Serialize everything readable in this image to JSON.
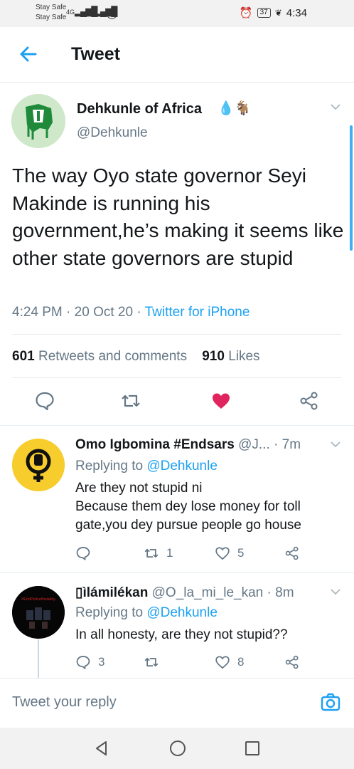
{
  "status_bar": {
    "carrier_1": "Stay Safe",
    "carrier_2": "Stay Safe",
    "signal_1": "4G",
    "signal_2": "4G",
    "battery": "37",
    "time": "4:34"
  },
  "app_bar": {
    "title": "Tweet"
  },
  "tweet": {
    "author_name": "Dehkunle of Africa",
    "author_emoji": "💧🐐",
    "author_handle": "@Dehkunle",
    "text": "The way Oyo state governor Seyi Makinde is running his government,he’s making it seems like other state governors are stupid",
    "time": "4:24 PM",
    "date": "20 Oct 20",
    "source": "Twitter for iPhone",
    "retweets_count": "601",
    "retweets_label": "Retweets and comments",
    "likes_count": "910",
    "likes_label": "Likes",
    "liked": true,
    "like_color": "#e0245e"
  },
  "replies": [
    {
      "name": "Omo Igbomina #Endsars",
      "handle": "@J...",
      "time": "7m",
      "replying_label": "Replying to",
      "replying_to": "@Dehkunle",
      "text_line1": "Are they not stupid ni",
      "text_line2": "Because them dey lose money for toll",
      "text_line3": "gate,you dey pursue people go house",
      "comments": "",
      "retweets": "1",
      "likes": "5"
    },
    {
      "name": "ìlámilékan",
      "name_prefix_glyph": "▯",
      "handle": "@O_la_mi_le_kan",
      "time": "8m",
      "replying_label": "Replying to",
      "replying_to": "@Dehkunle",
      "text_line1": "In all honesty, are they not stupid??",
      "comments": "3",
      "retweets": "",
      "likes": "8",
      "avatar_caption": "#EndPoliceBrutality"
    }
  ],
  "reply_bar": {
    "placeholder": "Tweet your reply"
  },
  "colors": {
    "accent": "#1da1f2",
    "secondary_text": "#657786",
    "like": "#e0245e",
    "divider": "#e6ecf0"
  },
  "icons": {
    "back": "arrow-left-icon",
    "caret": "chevron-down-icon",
    "comment": "comment-icon",
    "retweet": "retweet-icon",
    "like": "heart-icon",
    "share": "share-icon",
    "camera": "camera-icon"
  }
}
